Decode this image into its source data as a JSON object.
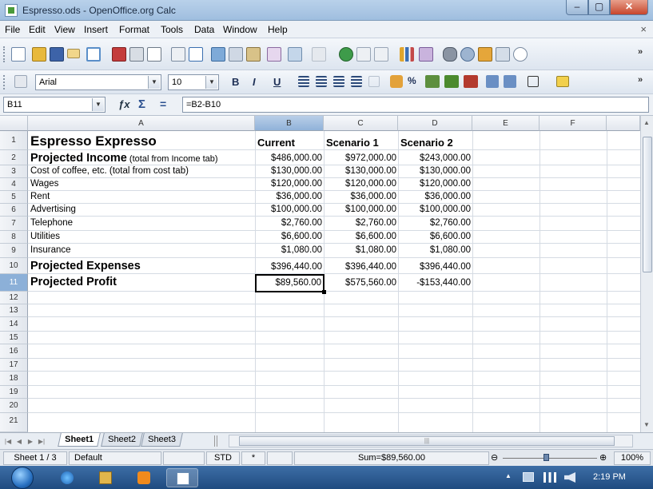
{
  "window": {
    "title": "Espresso.ods - OpenOffice.org Calc",
    "min_glyph": "–",
    "max_glyph": "▢",
    "close_glyph": "✕"
  },
  "menu": {
    "items": [
      "File",
      "Edit",
      "View",
      "Insert",
      "Format",
      "Tools",
      "Data",
      "Window",
      "Help"
    ],
    "close_glyph": "×"
  },
  "format_toolbar": {
    "font_name": "Arial",
    "font_size": "10",
    "bold": "B",
    "italic": "I",
    "underline": "U"
  },
  "formula_bar": {
    "cell_ref": "B11",
    "fx": "ƒx",
    "sum": "Σ",
    "equals": "=",
    "formula": "=B2-B10"
  },
  "columns": [
    "A",
    "B",
    "C",
    "D",
    "E",
    "F"
  ],
  "selected_column": "B",
  "rows": [
    {
      "num": "1",
      "a": "Espresso Expresso",
      "b": "Current",
      "c": "Scenario 1",
      "d": "Scenario 2",
      "style": "header"
    },
    {
      "num": "2",
      "a": "Projected Income",
      "a_note": " (total from Income tab)",
      "b": "$486,000.00",
      "c": "$972,000.00",
      "d": "$243,000.00",
      "style": "bold"
    },
    {
      "num": "3",
      "a": "Cost of coffee, etc. (total from cost tab)",
      "b": "$130,000.00",
      "c": "$130,000.00",
      "d": "$130,000.00"
    },
    {
      "num": "4",
      "a": "Wages",
      "b": "$120,000.00",
      "c": "$120,000.00",
      "d": "$120,000.00"
    },
    {
      "num": "5",
      "a": "Rent",
      "b": "$36,000.00",
      "c": "$36,000.00",
      "d": "$36,000.00"
    },
    {
      "num": "6",
      "a": "Advertising",
      "b": "$100,000.00",
      "c": "$100,000.00",
      "d": "$100,000.00"
    },
    {
      "num": "7",
      "a": "Telephone",
      "b": "$2,760.00",
      "c": "$2,760.00",
      "d": "$2,760.00"
    },
    {
      "num": "8",
      "a": "Utilities",
      "b": "$6,600.00",
      "c": "$6,600.00",
      "d": "$6,600.00"
    },
    {
      "num": "9",
      "a": "Insurance",
      "b": "$1,080.00",
      "c": "$1,080.00",
      "d": "$1,080.00"
    },
    {
      "num": "10",
      "a": "Projected Expenses",
      "b": "$396,440.00",
      "c": "$396,440.00",
      "d": "$396,440.00",
      "style": "bold"
    },
    {
      "num": "11",
      "a": "Projected Profit",
      "b": "$89,560.00",
      "c": "$575,560.00",
      "d": "-$153,440.00",
      "style": "bold"
    }
  ],
  "selected_row": "11",
  "empty_rows": [
    "12",
    "13",
    "14",
    "15",
    "16",
    "17",
    "18",
    "19",
    "20",
    "21"
  ],
  "sheet_tabs": [
    "Sheet1",
    "Sheet2",
    "Sheet3"
  ],
  "active_sheet": "Sheet1",
  "status": {
    "sheet": "Sheet 1 / 3",
    "style": "Default",
    "mode": "STD",
    "modified": "*",
    "sum": "Sum=$89,560.00",
    "zoom_minus": "⊖",
    "zoom_plus": "⊕",
    "zoom": "100%"
  },
  "taskbar": {
    "time": "2:19 PM"
  },
  "colors": {
    "selection_header": "#90b2d9",
    "titlebar": "#b9d1ea",
    "taskbar": "#1f4b80"
  }
}
